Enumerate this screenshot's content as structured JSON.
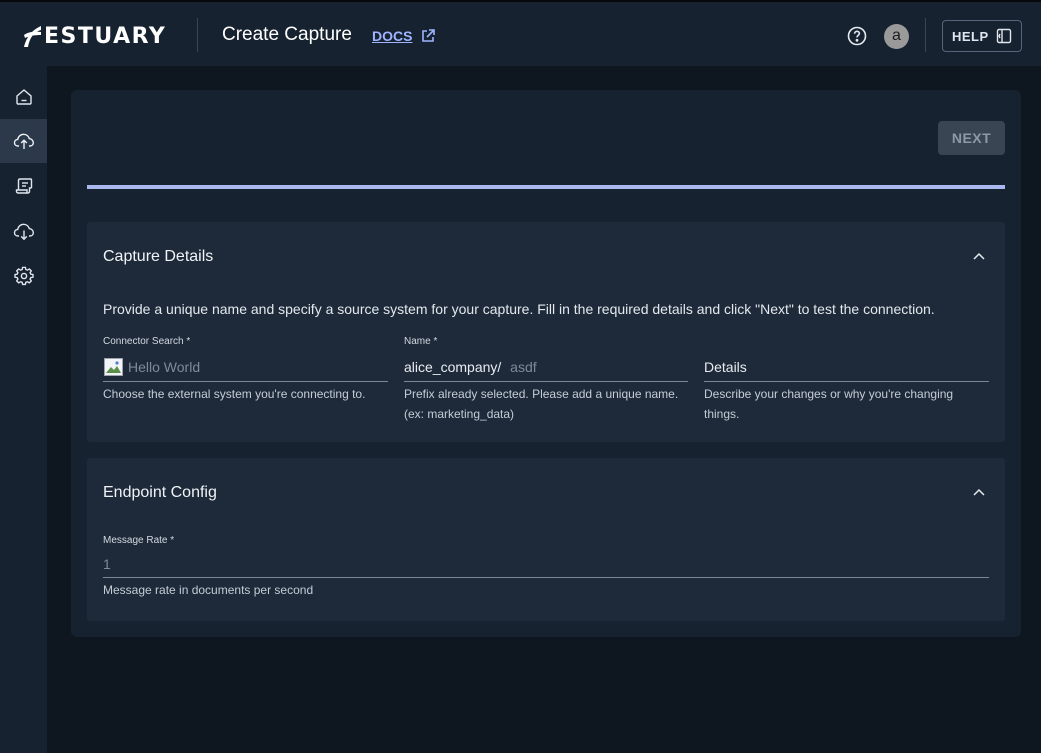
{
  "header": {
    "brand": "ESTUARY",
    "page_title": "Create Capture",
    "docs_label": "DOCS",
    "avatar_initial": "a",
    "help_label": "HELP"
  },
  "sidebar": {
    "items": [
      {
        "icon": "home-icon",
        "active": false
      },
      {
        "icon": "cloud-upload-icon",
        "active": true
      },
      {
        "icon": "collections-icon",
        "active": false
      },
      {
        "icon": "cloud-download-icon",
        "active": false
      },
      {
        "icon": "gear-icon",
        "active": false
      }
    ]
  },
  "toolbar": {
    "next_label": "NEXT"
  },
  "capture_details": {
    "title": "Capture Details",
    "description": "Provide a unique name and specify a source system for your capture. Fill in the required details and click \"Next\" to test the connection.",
    "connector": {
      "label": "Connector Search *",
      "value": "Hello World",
      "help": "Choose the external system you're connecting to."
    },
    "name": {
      "label": "Name *",
      "prefix": "alice_company/",
      "value": "asdf",
      "help_line1": "Prefix already selected. Please add a unique name.",
      "help_line2": "(ex: marketing_data)"
    },
    "details": {
      "placeholder": "Details",
      "help_line1": "Describe your changes or why you're changing",
      "help_line2": "things."
    }
  },
  "endpoint_config": {
    "title": "Endpoint Config",
    "message_rate": {
      "label": "Message Rate *",
      "value": "1",
      "help": "Message rate in documents per second"
    }
  },
  "colors": {
    "background": "#0e1620",
    "surface": "#172230",
    "section": "#1e2a39",
    "accent_link": "#9fb4ff",
    "progress": "#aab8f0"
  }
}
